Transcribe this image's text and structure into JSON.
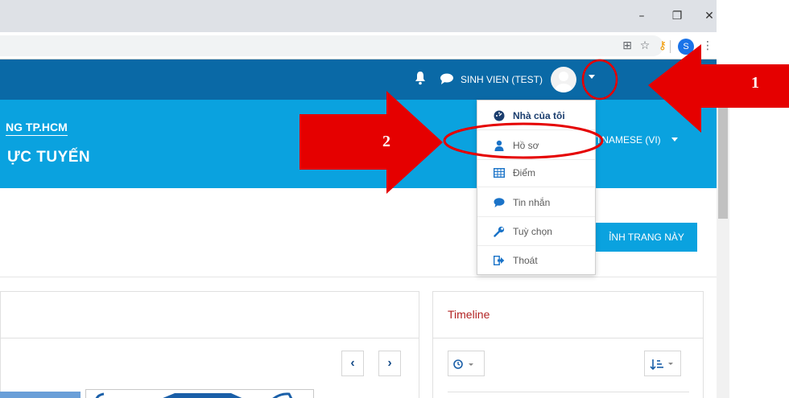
{
  "browser": {
    "window_buttons": {
      "minimize": "–",
      "restore": "❐",
      "close": "✕"
    },
    "toolbar_icons": {
      "translate": "⊞",
      "star": "☆",
      "key": "⚷",
      "menu": "⋮"
    },
    "profile_initial": "S"
  },
  "navbar": {
    "user_name": "SINH VIEN (TEST)",
    "icons": [
      "bell-icon",
      "chat-icon",
      "avatar",
      "caret-down-icon"
    ],
    "color": "#0a69a6"
  },
  "header": {
    "site_line1": "NG TP.HCM",
    "site_line2": "ỰC TUYẾN",
    "language": "TNAMESE (VI)",
    "color": "#0aa2df"
  },
  "user_menu": {
    "items": [
      {
        "label": "Nhà của tôi",
        "icon": "dashboard-icon"
      },
      {
        "label": "Hồ sơ",
        "icon": "user-icon"
      },
      {
        "label": "Điểm",
        "icon": "table-icon"
      },
      {
        "label": "Tin nhắn",
        "icon": "chat-icon"
      },
      {
        "label": "Tuỳ chọn",
        "icon": "wrench-icon"
      },
      {
        "label": "Thoát",
        "icon": "signout-icon"
      }
    ]
  },
  "page": {
    "customize_button": "ỈNH TRANG NÀY",
    "pager": {
      "prev": "‹",
      "next": "›"
    },
    "timeline": {
      "title": "Timeline",
      "sort_icon": "sort-icon",
      "filter_icon": "clock-icon"
    }
  },
  "annotations": {
    "step1": "1",
    "step2": "2",
    "color": "#e50000"
  }
}
